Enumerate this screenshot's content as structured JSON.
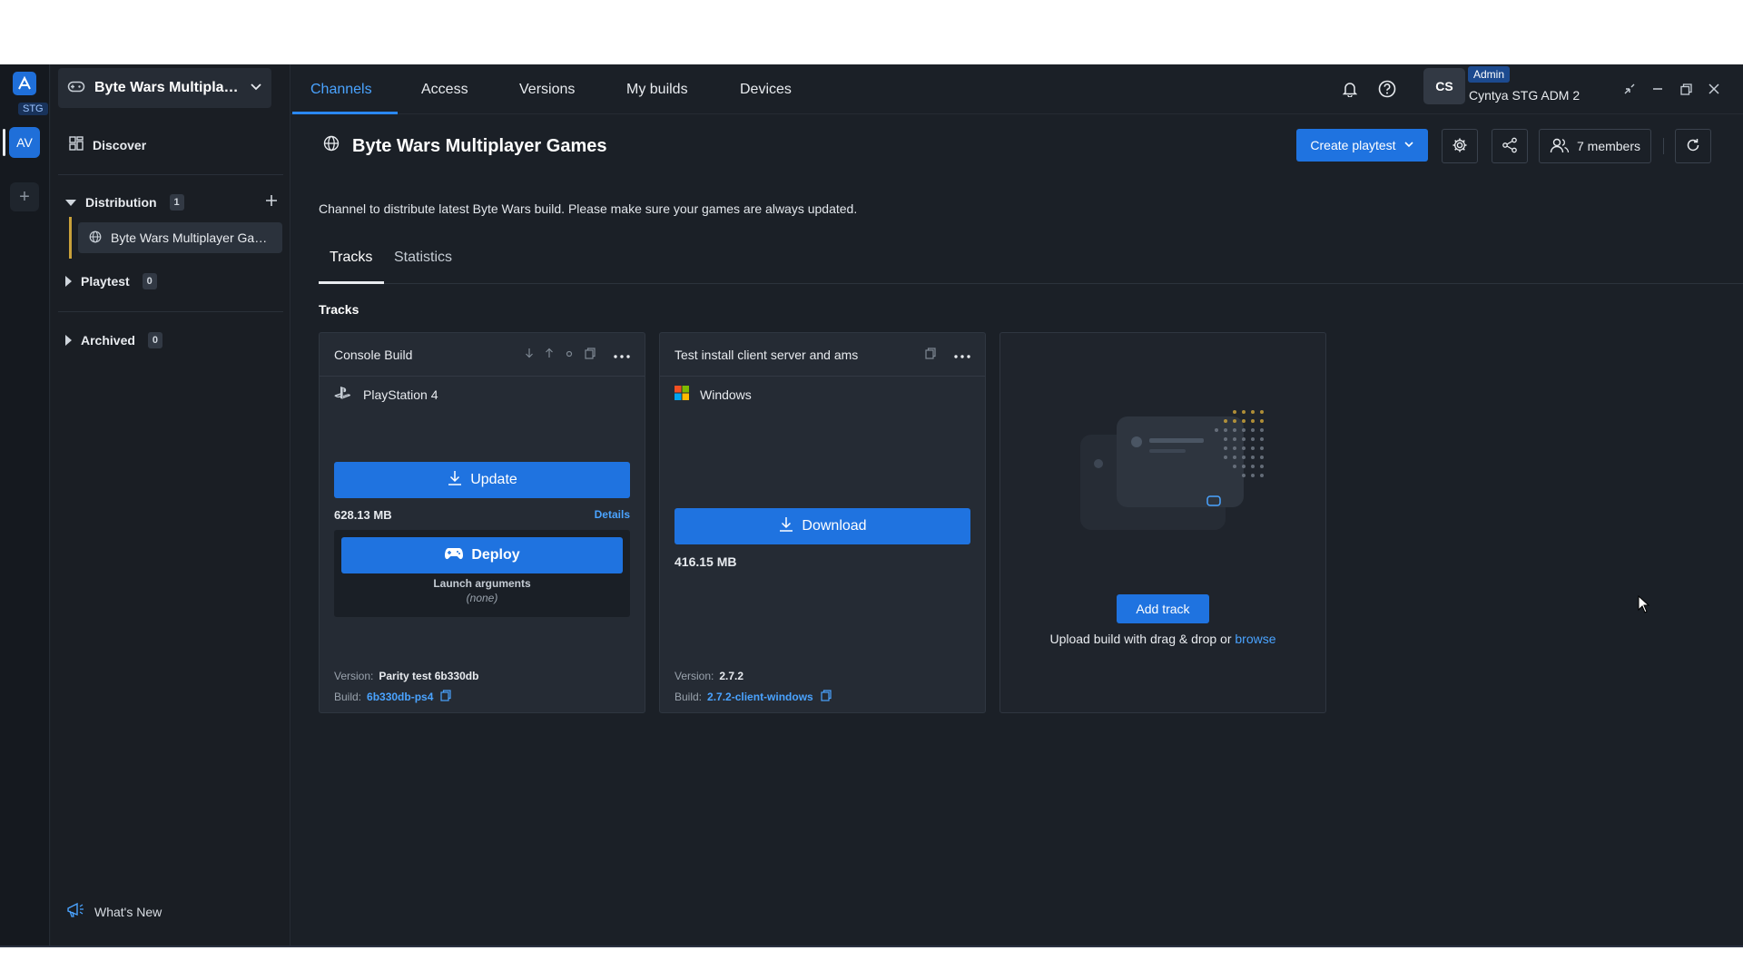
{
  "rail": {
    "env_badge": "STG",
    "avatar_initials": "AV",
    "add_label": "+"
  },
  "sidebar": {
    "game_name": "Byte Wars Multiplay...",
    "discover": "Discover",
    "sections": [
      {
        "label": "Distribution",
        "count": "1",
        "expanded": true
      },
      {
        "label": "Playtest",
        "count": "0",
        "expanded": false
      },
      {
        "label": "Archived",
        "count": "0",
        "expanded": false
      }
    ],
    "channel_item": "Byte Wars Multiplayer Gam...",
    "whats_new": "What's New"
  },
  "topbar": {
    "tabs": [
      "Channels",
      "Access",
      "Versions",
      "My builds",
      "Devices"
    ],
    "active_tab": "Channels",
    "user_initials": "CS",
    "user_role": "Admin",
    "user_name": "Cyntya STG ADM 2"
  },
  "main": {
    "title": "Byte Wars Multiplayer Games",
    "create_playtest": "Create playtest",
    "members": "7 members",
    "description": "Channel to distribute latest Byte Wars build. Please make sure your games are always updated.",
    "subtabs": [
      "Tracks",
      "Statistics"
    ],
    "section_label": "Tracks"
  },
  "tracks": [
    {
      "name": "Console Build",
      "platform": "PlayStation 4",
      "action": "Update",
      "size": "628.13 MB",
      "details": "Details",
      "deploy": "Deploy",
      "launch_label": "Launch arguments",
      "launch_value": "(none)",
      "version_label": "Version:",
      "version": "Parity test 6b330db",
      "build_label": "Build:",
      "build": "6b330db-ps4"
    },
    {
      "name": "Test install client server and ams",
      "platform": "Windows",
      "action": "Download",
      "size": "416.15 MB",
      "version_label": "Version:",
      "version": "2.7.2",
      "build_label": "Build:",
      "build": "2.7.2-client-windows"
    }
  ],
  "add_track": {
    "button": "Add track",
    "upload_text": "Upload build with drag & drop or",
    "browse": "browse"
  },
  "colors": {
    "accent": "#1f73e0",
    "background": "#1b2027",
    "sidebar": "#1a1e24",
    "card": "#252b34"
  }
}
